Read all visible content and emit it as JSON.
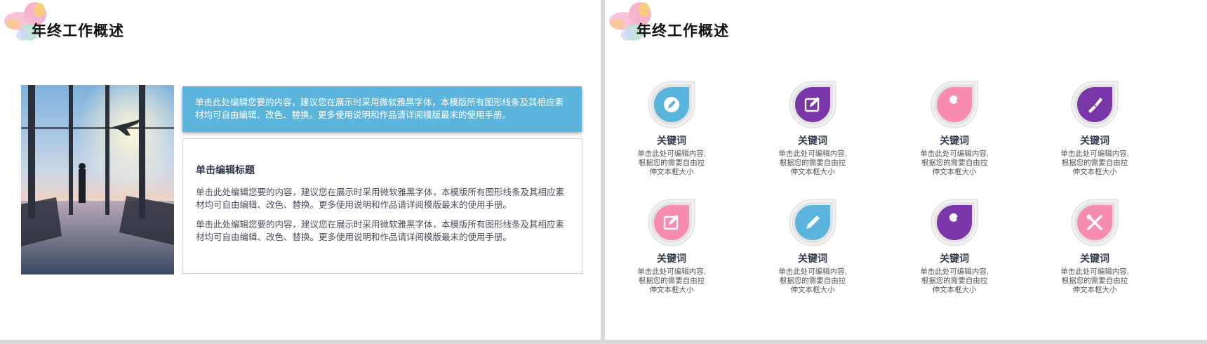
{
  "left_slide": {
    "title": "年终工作概述",
    "highlight_text": "单击此处编辑您要的内容，建议您在展示时采用微软雅黑字体，本模版所有图形线条及其相应素材均可自由编辑、改色、替换。更多使用说明和作品请详阅模版最末的使用手册。",
    "box_heading": "单击编辑标题",
    "box_paragraphs": [
      "单击此处编辑您要的内容，建议您在展示时采用微软雅黑字体，本模版所有图形线条及其相应素材均可自由编辑、改色、替换。更多使用说明和作品请详阅模版最末的使用手册。",
      "单击此处编辑您要的内容，建议您在展示时采用微软雅黑字体，本模版所有图形线条及其相应素材均可自由编辑、改色、替换。更多使用说明和作品请详阅模版最末的使用手册。"
    ]
  },
  "right_slide": {
    "title": "年终工作概述",
    "items": [
      {
        "keyword": "关键词",
        "desc_lines": [
          "单击此处可编辑内容,",
          "根据您的需要自由拉",
          "伸文本框大小"
        ],
        "color": "#5ab4dc",
        "icon": "pencil-icon"
      },
      {
        "keyword": "关键词",
        "desc_lines": [
          "单击此处可编辑内容,",
          "根据您的需要自由拉",
          "伸文本框大小"
        ],
        "color": "#7a35a8",
        "icon": "edit-icon"
      },
      {
        "keyword": "关键词",
        "desc_lines": [
          "单击此处可编辑内容,",
          "根据您的需要自由拉",
          "伸文本框大小"
        ],
        "color": "#f78cb0",
        "icon": "wrench-icon"
      },
      {
        "keyword": "关键词",
        "desc_lines": [
          "单击此处可编辑内容,",
          "根据您的需要自由拉",
          "伸文本框大小"
        ],
        "color": "#7a35a8",
        "icon": "screwdriver-icon"
      },
      {
        "keyword": "关键词",
        "desc_lines": [
          "单击此处可编辑内容,",
          "根据您的需要自由拉",
          "伸文本框大小"
        ],
        "color": "#f78cb0",
        "icon": "edit-icon"
      },
      {
        "keyword": "关键词",
        "desc_lines": [
          "单击此处可编辑内容,",
          "根据您的需要自由拉",
          "伸文本框大小"
        ],
        "color": "#5ab4dc",
        "icon": "pen-icon"
      },
      {
        "keyword": "关键词",
        "desc_lines": [
          "单击此处可编辑内容,",
          "根据您的需要自由拉",
          "伸文本框大小"
        ],
        "color": "#7a35a8",
        "icon": "wrench-icon"
      },
      {
        "keyword": "关键词",
        "desc_lines": [
          "单击此处可编辑内容,",
          "根据您的需要自由拉",
          "伸文本框大小"
        ],
        "color": "#f78cb0",
        "icon": "tools-icon"
      }
    ]
  }
}
